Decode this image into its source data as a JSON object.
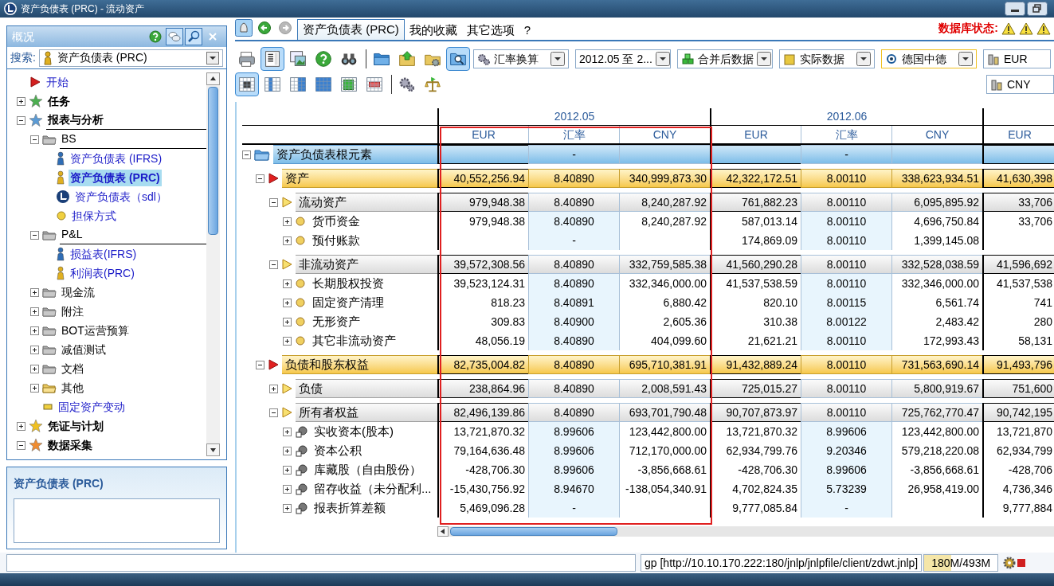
{
  "window": {
    "title": "资产负债表 (PRC) - 流动资产"
  },
  "sidebar": {
    "title": "概况",
    "header_buttons": [
      {
        "kind": "help",
        "pressed": false
      },
      {
        "kind": "chat",
        "pressed": true
      },
      {
        "kind": "find",
        "pressed": true
      },
      {
        "kind": "close",
        "pressed": false
      }
    ],
    "search_label": "搜索:",
    "search_value": "资产负债表 (PRC)",
    "tree": [
      {
        "label": "开始",
        "kind": "start",
        "selected": false
      },
      {
        "label": "任务",
        "kind": "category",
        "color": "#4caf50",
        "expanded": false
      },
      {
        "label": "报表与分析",
        "kind": "category",
        "color": "#5b9bd5",
        "expanded": true,
        "children": [
          {
            "label": "BS",
            "kind": "folder",
            "expanded": true,
            "children": [
              {
                "label": "资产负债表 (IFRS)",
                "kind": "report",
                "color": "#2f6db5",
                "selected": false
              },
              {
                "label": "资产负债表 (PRC)",
                "kind": "report",
                "color": "#e0b020",
                "selected": true
              },
              {
                "label": "资产负债表（sdl）",
                "kind": "logo",
                "selected": false
              },
              {
                "label": "担保方式",
                "kind": "dot",
                "selected": false
              }
            ]
          },
          {
            "label": "P&L",
            "kind": "folder",
            "expanded": true,
            "children": [
              {
                "label": "损益表(IFRS)",
                "kind": "report",
                "color": "#2f6db5",
                "selected": false
              },
              {
                "label": "利润表(PRC)",
                "kind": "report",
                "color": "#e0b020",
                "selected": false
              }
            ]
          },
          {
            "label": "现金流",
            "kind": "folder",
            "expanded": false
          },
          {
            "label": "附注",
            "kind": "folder",
            "expanded": false
          },
          {
            "label": "BOT运营预算",
            "kind": "folder",
            "expanded": false
          },
          {
            "label": "减值测试",
            "kind": "folder",
            "expanded": false
          },
          {
            "label": "文档",
            "kind": "folder",
            "expanded": false
          },
          {
            "label": "其他",
            "kind": "open-folder",
            "expanded": false
          },
          {
            "label": "固定资产变动",
            "kind": "form",
            "selected": false
          }
        ]
      },
      {
        "label": "凭证与计划",
        "kind": "category",
        "color": "#f0c020",
        "expanded": false
      },
      {
        "label": "数据采集",
        "kind": "category",
        "color": "#f08c30",
        "expanded": true
      }
    ],
    "detail_title": "资产负债表 (PRC)"
  },
  "nav_buttons": [
    {
      "kind": "alert",
      "pressed": true,
      "disabled": false
    },
    {
      "kind": "back",
      "pressed": false,
      "disabled": false
    },
    {
      "kind": "forward",
      "pressed": false,
      "disabled": true
    }
  ],
  "tabs": [
    {
      "label": "资产负债表 (PRC)",
      "selected": true
    },
    {
      "label": "我的收藏",
      "selected": false
    },
    {
      "label": "其它选项",
      "selected": false
    },
    {
      "label": "?",
      "selected": false
    }
  ],
  "db_status": {
    "label": "数据库状态:",
    "indicators": [
      {
        "kind": "warning"
      },
      {
        "kind": "warning"
      },
      {
        "kind": "warning"
      }
    ]
  },
  "toolbar": {
    "row_1": [
      {
        "kind": "print",
        "pressed": false
      },
      {
        "kind": "layout",
        "pressed": true
      },
      {
        "kind": "window",
        "pressed": false
      },
      {
        "kind": "help",
        "pressed": false
      },
      {
        "kind": "binoculars",
        "pressed": false
      },
      {
        "kind": "separator"
      },
      {
        "kind": "folder",
        "pressed": false
      },
      {
        "kind": "folder-up",
        "pressed": false
      },
      {
        "kind": "folder-gear",
        "pressed": false
      },
      {
        "kind": "folder-search",
        "pressed": true
      }
    ],
    "row_2": [
      {
        "kind": "text-table",
        "pressed": true
      },
      {
        "kind": "grid-left",
        "pressed": false
      },
      {
        "kind": "grid-middle",
        "pressed": false
      },
      {
        "kind": "grid-full",
        "pressed": false
      },
      {
        "kind": "cube",
        "pressed": false
      },
      {
        "kind": "red-table",
        "pressed": false
      },
      {
        "kind": "separator"
      },
      {
        "kind": "gears",
        "pressed": false
      },
      {
        "kind": "scales",
        "pressed": false
      }
    ],
    "dropdowns": [
      {
        "label": "汇率换算",
        "kind": "gears",
        "focused": false
      },
      {
        "label": "2012.05 至 2...",
        "kind": "none",
        "focused": false
      },
      {
        "label": "合并后数据",
        "kind": "cubes",
        "focused": false
      },
      {
        "label": "实际数据",
        "kind": "cube",
        "focused": false
      },
      {
        "label": "德国中德",
        "kind": "radio",
        "focused": true
      },
      {
        "label": "EUR",
        "kind": "coins",
        "focused": false
      }
    ],
    "currency_dropdown": {
      "label": "CNY"
    }
  },
  "table": {
    "periods": [
      {
        "label": "2012.05",
        "columns": [
          {
            "label": "EUR",
            "kind": "amount"
          },
          {
            "label": "汇率",
            "kind": "rate"
          },
          {
            "label": "CNY",
            "kind": "amount"
          }
        ]
      },
      {
        "label": "2012.06",
        "columns": [
          {
            "label": "EUR",
            "kind": "amount"
          },
          {
            "label": "汇率",
            "kind": "rate"
          },
          {
            "label": "CNY",
            "kind": "amount"
          }
        ]
      },
      {
        "columns": [
          {
            "label": "EUR",
            "kind": "amount"
          }
        ]
      }
    ],
    "rows": [
      {
        "label": "资产负债表根元素",
        "kind": "root",
        "expanded": true,
        "cells": [
          {},
          {
            "text": "-"
          },
          {},
          {},
          {
            "text": "-"
          },
          {},
          {}
        ],
        "children": [
          {
            "label": "资产",
            "kind": "section",
            "expanded": true,
            "cells": [
              {
                "text": "40,552,256.94"
              },
              {
                "text": "8.40890"
              },
              {
                "text": "340,999,873.30"
              },
              {
                "text": "42,322,172.51"
              },
              {
                "text": "8.00110"
              },
              {
                "text": "338,623,934.51"
              },
              {
                "text": "41,630,398"
              }
            ],
            "children": [
              {
                "label": "流动资产",
                "kind": "group",
                "expanded": true,
                "cells": [
                  {
                    "text": "979,948.38"
                  },
                  {
                    "text": "8.40890"
                  },
                  {
                    "text": "8,240,287.92"
                  },
                  {
                    "text": "761,882.23"
                  },
                  {
                    "text": "8.00110"
                  },
                  {
                    "text": "6,095,895.92"
                  },
                  {
                    "text": "33,706"
                  }
                ],
                "children": [
                  {
                    "label": "货币资金",
                    "kind": "item",
                    "expanded": false,
                    "cells": [
                      {
                        "text": "979,948.38"
                      },
                      {
                        "text": "8.40890"
                      },
                      {
                        "text": "8,240,287.92"
                      },
                      {
                        "text": "587,013.14"
                      },
                      {
                        "text": "8.00110"
                      },
                      {
                        "text": "4,696,750.84"
                      },
                      {
                        "text": "33,706"
                      }
                    ]
                  },
                  {
                    "label": "预付账款",
                    "kind": "item",
                    "expanded": false,
                    "cells": [
                      {},
                      {
                        "text": "-"
                      },
                      {},
                      {
                        "text": "174,869.09"
                      },
                      {
                        "text": "8.00110"
                      },
                      {
                        "text": "1,399,145.08"
                      },
                      {}
                    ]
                  }
                ]
              },
              {
                "label": "非流动资产",
                "kind": "group",
                "expanded": true,
                "cells": [
                  {
                    "text": "39,572,308.56"
                  },
                  {
                    "text": "8.40890"
                  },
                  {
                    "text": "332,759,585.38"
                  },
                  {
                    "text": "41,560,290.28"
                  },
                  {
                    "text": "8.00110"
                  },
                  {
                    "text": "332,528,038.59"
                  },
                  {
                    "text": "41,596,692"
                  }
                ],
                "children": [
                  {
                    "label": "长期股权投资",
                    "kind": "item",
                    "expanded": false,
                    "cells": [
                      {
                        "text": "39,523,124.31"
                      },
                      {
                        "text": "8.40890"
                      },
                      {
                        "text": "332,346,000.00"
                      },
                      {
                        "text": "41,537,538.59"
                      },
                      {
                        "text": "8.00110"
                      },
                      {
                        "text": "332,346,000.00"
                      },
                      {
                        "text": "41,537,538"
                      }
                    ]
                  },
                  {
                    "label": "固定资产清理",
                    "kind": "item",
                    "expanded": false,
                    "cells": [
                      {
                        "text": "818.23"
                      },
                      {
                        "text": "8.40891"
                      },
                      {
                        "text": "6,880.42"
                      },
                      {
                        "text": "820.10"
                      },
                      {
                        "text": "8.00115"
                      },
                      {
                        "text": "6,561.74"
                      },
                      {
                        "text": "741"
                      }
                    ]
                  },
                  {
                    "label": "无形资产",
                    "kind": "item",
                    "expanded": false,
                    "cells": [
                      {
                        "text": "309.83"
                      },
                      {
                        "text": "8.40900"
                      },
                      {
                        "text": "2,605.36"
                      },
                      {
                        "text": "310.38"
                      },
                      {
                        "text": "8.00122"
                      },
                      {
                        "text": "2,483.42"
                      },
                      {
                        "text": "280"
                      }
                    ]
                  },
                  {
                    "label": "其它非流动资产",
                    "kind": "item",
                    "expanded": false,
                    "cells": [
                      {
                        "text": "48,056.19"
                      },
                      {
                        "text": "8.40890"
                      },
                      {
                        "text": "404,099.60"
                      },
                      {
                        "text": "21,621.21"
                      },
                      {
                        "text": "8.00110"
                      },
                      {
                        "text": "172,993.43"
                      },
                      {
                        "text": "58,131"
                      }
                    ]
                  }
                ]
              }
            ]
          },
          {
            "label": "负债和股东权益",
            "kind": "section",
            "expanded": true,
            "cells": [
              {
                "text": "82,735,004.82"
              },
              {
                "text": "8.40890"
              },
              {
                "text": "695,710,381.91"
              },
              {
                "text": "91,432,889.24"
              },
              {
                "text": "8.00110"
              },
              {
                "text": "731,563,690.14"
              },
              {
                "text": "91,493,796"
              }
            ],
            "children": [
              {
                "label": "负债",
                "kind": "group",
                "expanded": false,
                "cells": [
                  {
                    "text": "238,864.96"
                  },
                  {
                    "text": "8.40890"
                  },
                  {
                    "text": "2,008,591.43"
                  },
                  {
                    "text": "725,015.27"
                  },
                  {
                    "text": "8.00110"
                  },
                  {
                    "text": "5,800,919.67"
                  },
                  {
                    "text": "751,600"
                  }
                ]
              },
              {
                "label": "所有者权益",
                "kind": "group",
                "expanded": true,
                "cells": [
                  {
                    "text": "82,496,139.86"
                  },
                  {
                    "text": "8.40890"
                  },
                  {
                    "text": "693,701,790.48"
                  },
                  {
                    "text": "90,707,873.97"
                  },
                  {
                    "text": "8.00110"
                  },
                  {
                    "text": "725,762,770.47"
                  },
                  {
                    "text": "90,742,195"
                  }
                ],
                "children": [
                  {
                    "label": "实收资本(股本)",
                    "kind": "equity-item",
                    "expanded": false,
                    "cells": [
                      {
                        "text": "13,721,870.32"
                      },
                      {
                        "text": "8.99606"
                      },
                      {
                        "text": "123,442,800.00"
                      },
                      {
                        "text": "13,721,870.32"
                      },
                      {
                        "text": "8.99606"
                      },
                      {
                        "text": "123,442,800.00"
                      },
                      {
                        "text": "13,721,870"
                      }
                    ]
                  },
                  {
                    "label": "资本公积",
                    "kind": "equity-item",
                    "expanded": false,
                    "cells": [
                      {
                        "text": "79,164,636.48"
                      },
                      {
                        "text": "8.99606"
                      },
                      {
                        "text": "712,170,000.00"
                      },
                      {
                        "text": "62,934,799.76"
                      },
                      {
                        "text": "9.20346"
                      },
                      {
                        "text": "579,218,220.08"
                      },
                      {
                        "text": "62,934,799"
                      }
                    ]
                  },
                  {
                    "label": "库藏股（自由股份）",
                    "kind": "equity-item",
                    "expanded": false,
                    "cells": [
                      {
                        "text": "-428,706.30"
                      },
                      {
                        "text": "8.99606"
                      },
                      {
                        "text": "-3,856,668.61"
                      },
                      {
                        "text": "-428,706.30"
                      },
                      {
                        "text": "8.99606"
                      },
                      {
                        "text": "-3,856,668.61"
                      },
                      {
                        "text": "-428,706"
                      }
                    ]
                  },
                  {
                    "label": "留存收益（未分配利...",
                    "kind": "equity-item",
                    "expanded": false,
                    "cells": [
                      {
                        "text": "-15,430,756.92"
                      },
                      {
                        "text": "8.94670"
                      },
                      {
                        "text": "-138,054,340.91"
                      },
                      {
                        "text": "4,702,824.35"
                      },
                      {
                        "text": "5.73239"
                      },
                      {
                        "text": "26,958,419.00"
                      },
                      {
                        "text": "4,736,346"
                      }
                    ]
                  },
                  {
                    "label": "报表折算差额",
                    "kind": "equity-item",
                    "expanded": false,
                    "cells": [
                      {
                        "text": "5,469,096.28"
                      },
                      {
                        "text": "-"
                      },
                      {},
                      {
                        "text": "9,777,085.84"
                      },
                      {
                        "text": "-"
                      },
                      {},
                      {
                        "text": "9,777,884"
                      }
                    ]
                  }
                ]
              }
            ]
          }
        ]
      }
    ]
  },
  "status_bar": {
    "path": "gp [http://10.10.170.222:180/jnlp/jnlpfile/client/zdwt.jnlp]",
    "memory": "180M/493M",
    "memory_meter": {
      "level": 0.37
    }
  }
}
